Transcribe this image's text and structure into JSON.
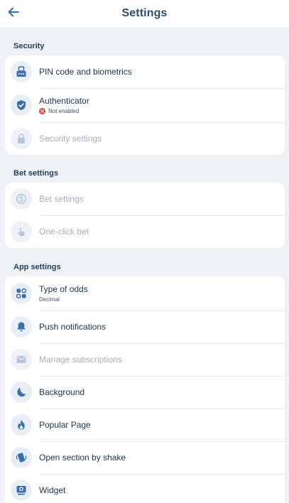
{
  "header": {
    "title": "Settings",
    "back_icon": "arrow-left-icon"
  },
  "colors": {
    "accent": "#3a6fb2",
    "icon_bg": "#e8eef6",
    "disabled_text": "#a5afbc",
    "page_bg": "#eef1f5",
    "error": "#e0453c"
  },
  "sections": {
    "security": {
      "title": "Security",
      "items": [
        {
          "label": "PIN code and biometrics",
          "icon": "pin-keypad-icon"
        },
        {
          "label": "Authenticator",
          "status": "Not enabled",
          "icon": "shield-check-icon"
        },
        {
          "label": "Security settings",
          "icon": "lock-icon"
        }
      ]
    },
    "bet": {
      "title": "Bet settings",
      "items": [
        {
          "label": "Bet settings",
          "icon": "dollar-coin-icon"
        },
        {
          "label": "One-click bet",
          "icon": "tap-hand-icon"
        }
      ]
    },
    "app": {
      "title": "App settings",
      "items": [
        {
          "label": "Type of odds",
          "value": "Decimal",
          "icon": "grid-odds-icon"
        },
        {
          "label": "Push notifications",
          "icon": "bell-icon"
        },
        {
          "label": "Manage subscriptions",
          "icon": "envelope-icon"
        },
        {
          "label": "Background",
          "icon": "moon-icon"
        },
        {
          "label": "Popular Page",
          "icon": "flame-icon"
        },
        {
          "label": "Open section by shake",
          "icon": "shake-phone-icon"
        },
        {
          "label": "Widget",
          "icon": "widget-icon"
        }
      ]
    }
  }
}
